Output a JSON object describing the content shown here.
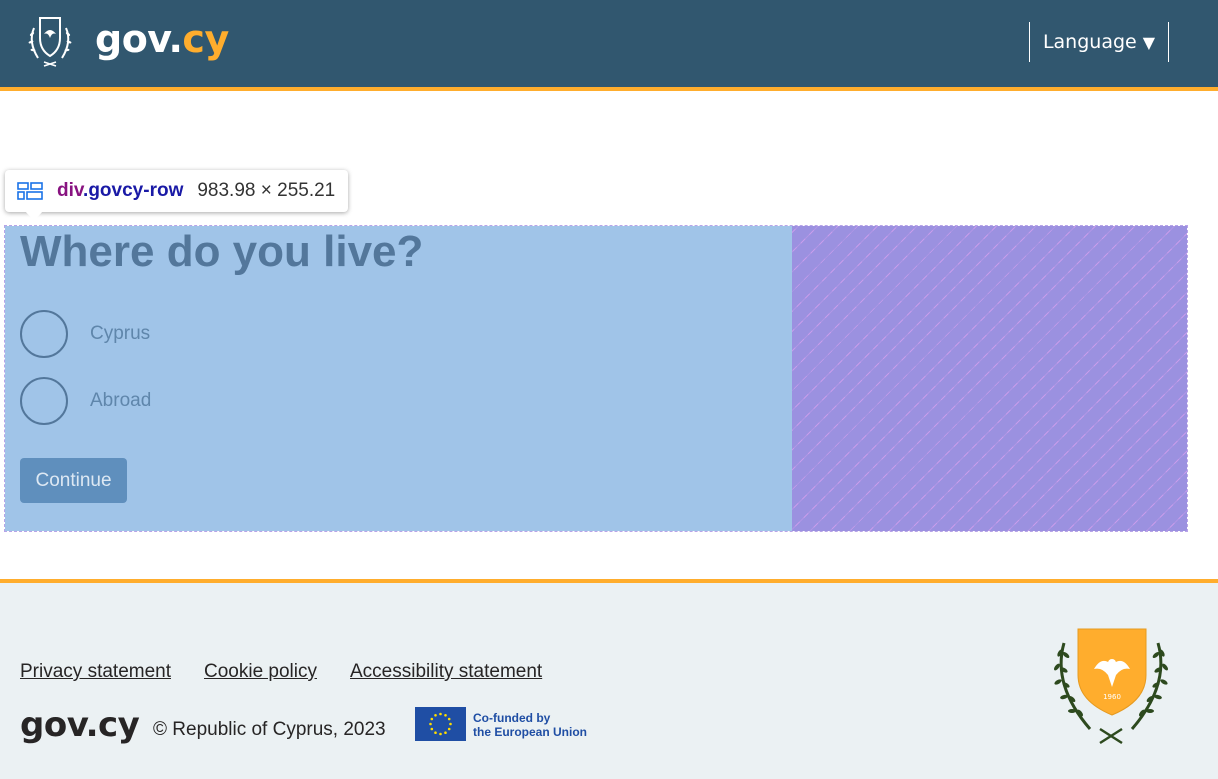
{
  "header": {
    "logo": {
      "main": "gov",
      "dot": ".",
      "accent": "cy"
    },
    "language_label": "Language",
    "language_arrow": "▼"
  },
  "devtools_tooltip": {
    "tag": "div",
    "class_name": ".govcy-row",
    "dimensions": "983.98 × 255.21"
  },
  "form": {
    "question": "Where do you live?",
    "options": [
      {
        "label": "Cyprus"
      },
      {
        "label": "Abroad"
      }
    ],
    "continue_label": "Continue"
  },
  "footer": {
    "links": [
      "Privacy statement",
      "Cookie policy",
      "Accessibility statement"
    ],
    "logo_text": "gov.cy",
    "copyright": "© Republic of Cyprus, 2023",
    "eu_line1": "Co-funded by",
    "eu_line2": "the European Union",
    "crest_year": "1960"
  },
  "colors": {
    "header_bg": "#31576f",
    "accent": "#ffad2d",
    "highlight_content": "#a0c4e8",
    "highlight_margin": "#9b91e0",
    "footer_bg": "#ebf1f3",
    "eu_blue": "#1f4ea4"
  }
}
